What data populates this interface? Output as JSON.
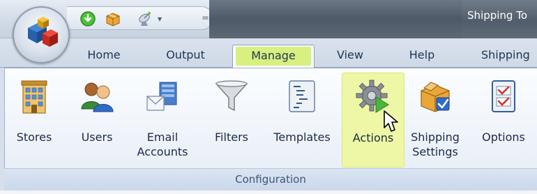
{
  "window": {
    "title": "Shipping To"
  },
  "quick_access": {
    "items": [
      {
        "icon": "green-download-icon"
      },
      {
        "icon": "package-icon"
      },
      {
        "icon": "satellite-dish-icon"
      }
    ],
    "dropdown_glyph": "▾",
    "separator_glyph": "="
  },
  "tabs": [
    {
      "label": "Home",
      "active": false
    },
    {
      "label": "Output",
      "active": false
    },
    {
      "label": "Manage",
      "active": true
    },
    {
      "label": "View",
      "active": false
    },
    {
      "label": "Help",
      "active": false
    },
    {
      "label": "Shipping",
      "active": false
    }
  ],
  "ribbon": {
    "group_label": "Configuration",
    "buttons": [
      {
        "label": "Stores",
        "icon": "building-icon"
      },
      {
        "label": "Users",
        "icon": "users-icon"
      },
      {
        "label": "Email\nAccounts",
        "icon": "email-icon"
      },
      {
        "label": "Filters",
        "icon": "funnel-icon"
      },
      {
        "label": "Templates",
        "icon": "template-document-icon"
      },
      {
        "label": "Actions",
        "icon": "gear-play-icon",
        "selected": true
      },
      {
        "label": "Shipping\nSettings",
        "icon": "shipping-box-icon"
      },
      {
        "label": "Options",
        "icon": "checklist-icon"
      }
    ]
  },
  "colors": {
    "highlight": "#d7f07f",
    "selected_button": "#eef7a6",
    "ribbon_border": "#9fb1c8",
    "text": "#1b2a44"
  }
}
